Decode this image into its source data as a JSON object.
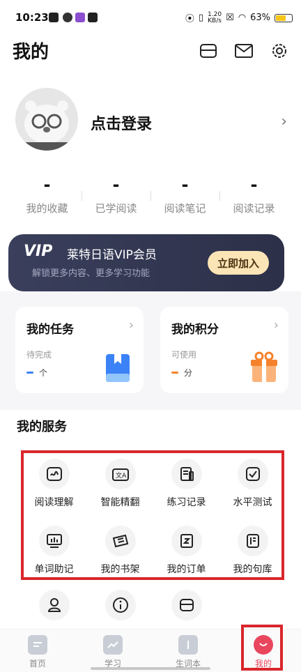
{
  "status_bar": {
    "time": "10:23",
    "net_speed_top": "1.20",
    "net_speed_bottom": "KB/s",
    "battery": "63%"
  },
  "header": {
    "title": "我的"
  },
  "profile": {
    "login_text": "点击登录"
  },
  "stats": [
    {
      "value": "-",
      "label": "我的收藏"
    },
    {
      "value": "-",
      "label": "已学阅读"
    },
    {
      "value": "-",
      "label": "阅读笔记"
    },
    {
      "value": "-",
      "label": "阅读记录"
    }
  ],
  "vip": {
    "logo": "VIP",
    "title": "莱特日语VIP会员",
    "subtitle": "解锁更多内容、更多学习功能",
    "button": "立即加入"
  },
  "cards": {
    "tasks": {
      "title": "我的任务",
      "subtitle": "待完成",
      "value": "个"
    },
    "points": {
      "title": "我的积分",
      "subtitle": "可使用",
      "value": "分"
    }
  },
  "services": {
    "title": "我的服务",
    "items": [
      {
        "label": "阅读理解",
        "icon": "reading-icon"
      },
      {
        "label": "智能精翻",
        "icon": "translate-icon"
      },
      {
        "label": "练习记录",
        "icon": "practice-icon"
      },
      {
        "label": "水平测试",
        "icon": "test-icon"
      },
      {
        "label": "单词助记",
        "icon": "word-icon"
      },
      {
        "label": "我的书架",
        "icon": "bookshelf-icon"
      },
      {
        "label": "我的订单",
        "icon": "order-icon"
      },
      {
        "label": "我的句库",
        "icon": "sentence-icon"
      }
    ]
  },
  "tabbar": [
    {
      "label": "首页"
    },
    {
      "label": "学习"
    },
    {
      "label": "生词本"
    },
    {
      "label": "我的"
    }
  ],
  "colors": {
    "accent": "#e9465e",
    "vip_bg": "#2c3048",
    "highlight_box": "#d9262c",
    "task_blue": "#3b82f6",
    "point_orange": "#f5822a"
  }
}
